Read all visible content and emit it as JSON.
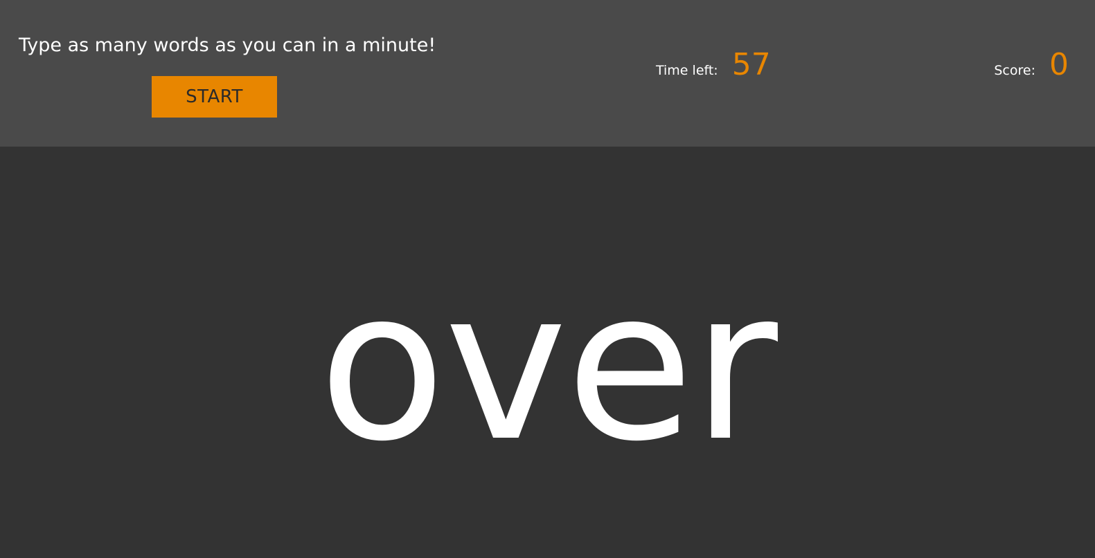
{
  "header": {
    "instructions": "Type as many words as you can in a minute!",
    "start_label": "START"
  },
  "timer": {
    "label": "Time left:",
    "value": "57"
  },
  "score": {
    "label": "Score:",
    "value": "0"
  },
  "game": {
    "current_word": "over"
  },
  "colors": {
    "header_bg": "#4a4a4a",
    "main_bg": "#333333",
    "accent": "#e88600",
    "text": "#ffffff"
  }
}
